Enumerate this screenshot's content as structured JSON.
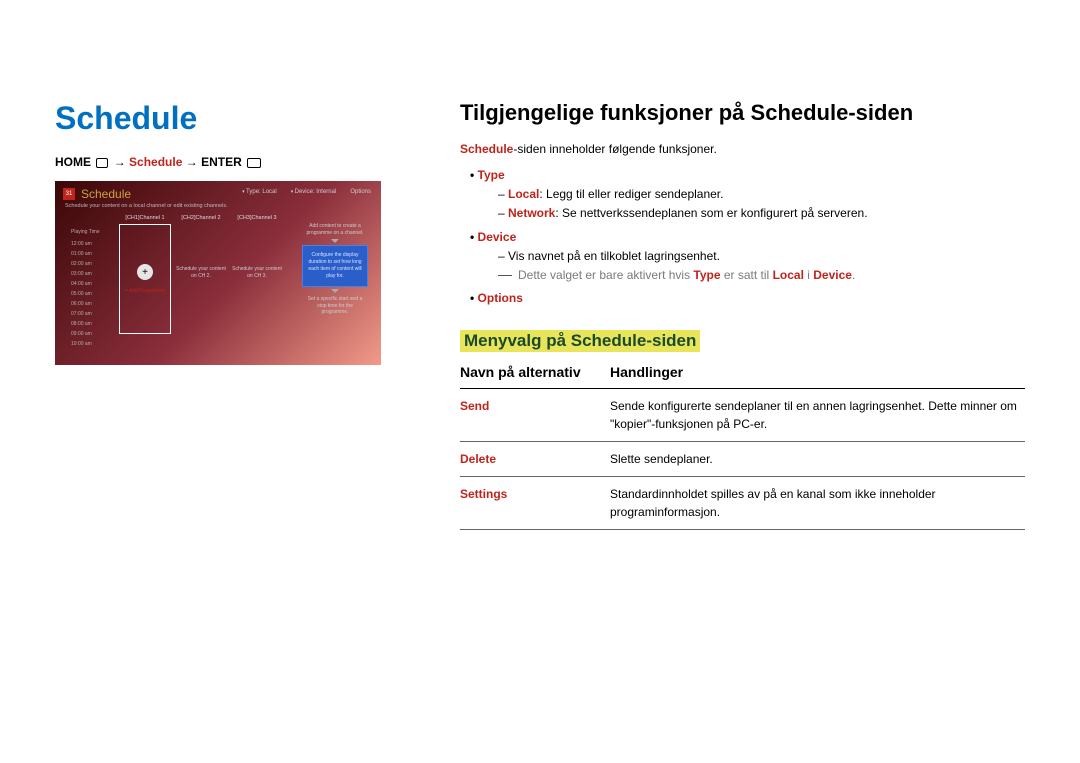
{
  "left": {
    "title": "Schedule",
    "breadcrumb": {
      "home": "HOME",
      "mid": "Schedule",
      "enter": "ENTER",
      "arrow": " → "
    },
    "mock": {
      "cal_num": "31",
      "title": "Schedule",
      "top_right": [
        "Type: Local",
        "Device: Internal",
        "Options"
      ],
      "subtitle": "Schedule your content on a local channel or edit existing channels.",
      "play_time_label": "Playing Time",
      "times": [
        "12:00 am",
        "01:00 am",
        "02:00 am",
        "03:00 am",
        "04:00 am",
        "05:00 am",
        "06:00 am",
        "07:00 am",
        "08:00 am",
        "09:00 am",
        "10:00 am"
      ],
      "cols": [
        {
          "head": "[CH1]Channel 1",
          "add_label": "+ Add Programme"
        },
        {
          "head": "[CH2]Channel 2",
          "text": "Schedule your content on CH 2."
        },
        {
          "head": "[CH3]Channel 3",
          "text": "Schedule your content on CH 3."
        }
      ],
      "side_top": "Add content to create a programme on a channel.",
      "blue": "Configure the display duration to set how long each item of content will play for.",
      "side_bot": "Set a specific start and a stop time for the programme."
    }
  },
  "right": {
    "h1": "Tilgjengelige funksjoner på Schedule-siden",
    "intro_pre": "Schedule",
    "intro_post": "-siden inneholder følgende funksjoner.",
    "items": [
      {
        "name": "Type",
        "subs": [
          {
            "b": "Local",
            "t": ": Legg til eller rediger sendeplaner."
          },
          {
            "b": "Network",
            "t": ": Se nettverkssendeplanen som er konfigurert på serveren."
          }
        ]
      },
      {
        "name": "Device",
        "subs": [
          {
            "t": "Vis navnet på en tilkoblet lagringsenhet."
          }
        ],
        "note_pre": "Dette valget er bare aktivert hvis ",
        "note_b1": "Type",
        "note_mid": " er satt til ",
        "note_b2": "Local",
        "note_i": " i ",
        "note_b3": "Device",
        "note_end": "."
      },
      {
        "name": "Options"
      }
    ],
    "sub_h2": "Menyvalg på Schedule-siden",
    "table": {
      "headers": [
        "Navn på alternativ",
        "Handlinger"
      ],
      "rows": [
        {
          "name": "Send",
          "desc": "Sende konfigurerte sendeplaner til en annen lagringsenhet. Dette minner om \"kopier\"-funksjonen på PC-er."
        },
        {
          "name": "Delete",
          "desc": "Slette sendeplaner."
        },
        {
          "name": "Settings",
          "desc": "Standardinnholdet spilles av på en kanal som ikke inneholder programinformasjon."
        }
      ]
    }
  }
}
